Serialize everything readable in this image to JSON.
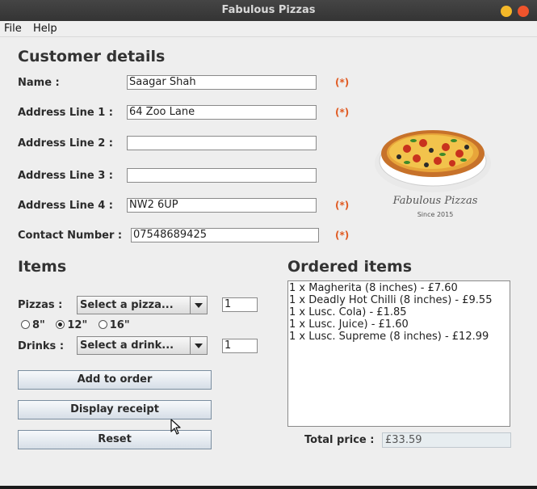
{
  "window": {
    "title": "Fabulous Pizzas"
  },
  "menu": {
    "file": "File",
    "help": "Help"
  },
  "customer": {
    "title": "Customer details",
    "required_mark": "(*)",
    "fields": {
      "name": {
        "label": "Name :",
        "value": "Saagar Shah"
      },
      "addr1": {
        "label": "Address Line 1 :",
        "value": "64 Zoo Lane"
      },
      "addr2": {
        "label": "Address Line 2 :",
        "value": ""
      },
      "addr3": {
        "label": "Address Line 3 :",
        "value": ""
      },
      "addr4": {
        "label": "Address Line 4 :",
        "value": "NW2 6UP"
      },
      "contact": {
        "label": "Contact Number :",
        "value": "07548689425"
      }
    }
  },
  "logo": {
    "brand": "Fabulous Pizzas",
    "since": "Since 2015"
  },
  "items": {
    "title": "Items",
    "pizzas_label": "Pizzas :",
    "pizza_select": "Select a pizza...",
    "pizza_qty": "1",
    "sizes": [
      "8\"",
      "12\"",
      "16\""
    ],
    "selected_size": "12\"",
    "drinks_label": "Drinks :",
    "drink_select": "Select a drink...",
    "drink_qty": "1"
  },
  "buttons": {
    "add": "Add to order",
    "receipt": "Display receipt",
    "reset": "Reset"
  },
  "ordered": {
    "title": "Ordered items",
    "items": [
      "1 x Magherita (8 inches) - £7.60",
      "1 x Deadly Hot Chilli (8 inches) - £9.55",
      "1 x Lusc. Cola) - £1.85",
      "1 x Lusc. Juice) - £1.60",
      "1 x Lusc. Supreme (8 inches) - £12.99"
    ],
    "total_label": "Total price :",
    "total_value": "£33.59"
  }
}
